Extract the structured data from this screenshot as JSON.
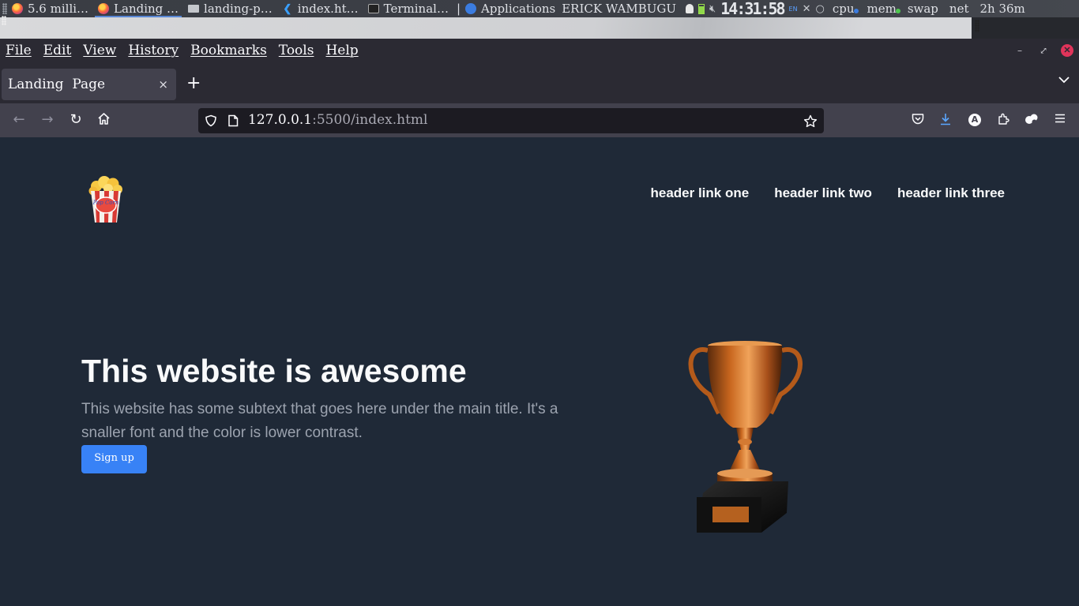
{
  "taskbar": {
    "tasks": [
      {
        "label": "5.6 milli…"
      },
      {
        "label": "Landing …"
      },
      {
        "label": "landing-p…"
      },
      {
        "label": "index.ht…"
      },
      {
        "label": "Terminal…"
      }
    ],
    "separator": "|",
    "applications_label": "Applications",
    "user_label": "ERICK WAMBUGU",
    "clock": "14:31:58",
    "keyboard_layout": "EN",
    "monitors": {
      "cpu": "cpu",
      "mem": "mem",
      "swap": "swap",
      "net": "net"
    },
    "uptime": "2h 36m",
    "monitor_colors": {
      "cpu": "#3b7ce0",
      "mem": "#4ec74e"
    }
  },
  "browser": {
    "menu": [
      "File",
      "Edit",
      "View",
      "History",
      "Bookmarks",
      "Tools",
      "Help"
    ],
    "window_controls": {
      "minimize": "–",
      "restore": "⤢",
      "close": "✕"
    },
    "tab": {
      "title": "Landing  Page",
      "close": "×"
    },
    "new_tab": "+",
    "tab_list": "⌵",
    "url": {
      "host": "127.0.0.1",
      "rest": ":5500/index.html"
    },
    "nav": {
      "back": "←",
      "forward": "→",
      "reload": "↻",
      "home": "⌂"
    },
    "toolbar_icons": [
      "pocket-icon",
      "download-icon",
      "account-icon",
      "extensions-icon",
      "addon-icon",
      "menu-icon"
    ],
    "account_initial": "A"
  },
  "page": {
    "nav_links": [
      "header link one",
      "header link two",
      "header link three"
    ],
    "hero": {
      "title": "This website is awesome",
      "subtitle": "This website has some subtext that goes here under the main title. It's a snaller font and the color is lower contrast.",
      "cta": "Sign up"
    },
    "colors": {
      "background": "#1f2937",
      "title": "#f9fafb",
      "subtitle": "#9ca3af",
      "button": "#3882f6"
    },
    "logo_text": "Pop Corn"
  }
}
